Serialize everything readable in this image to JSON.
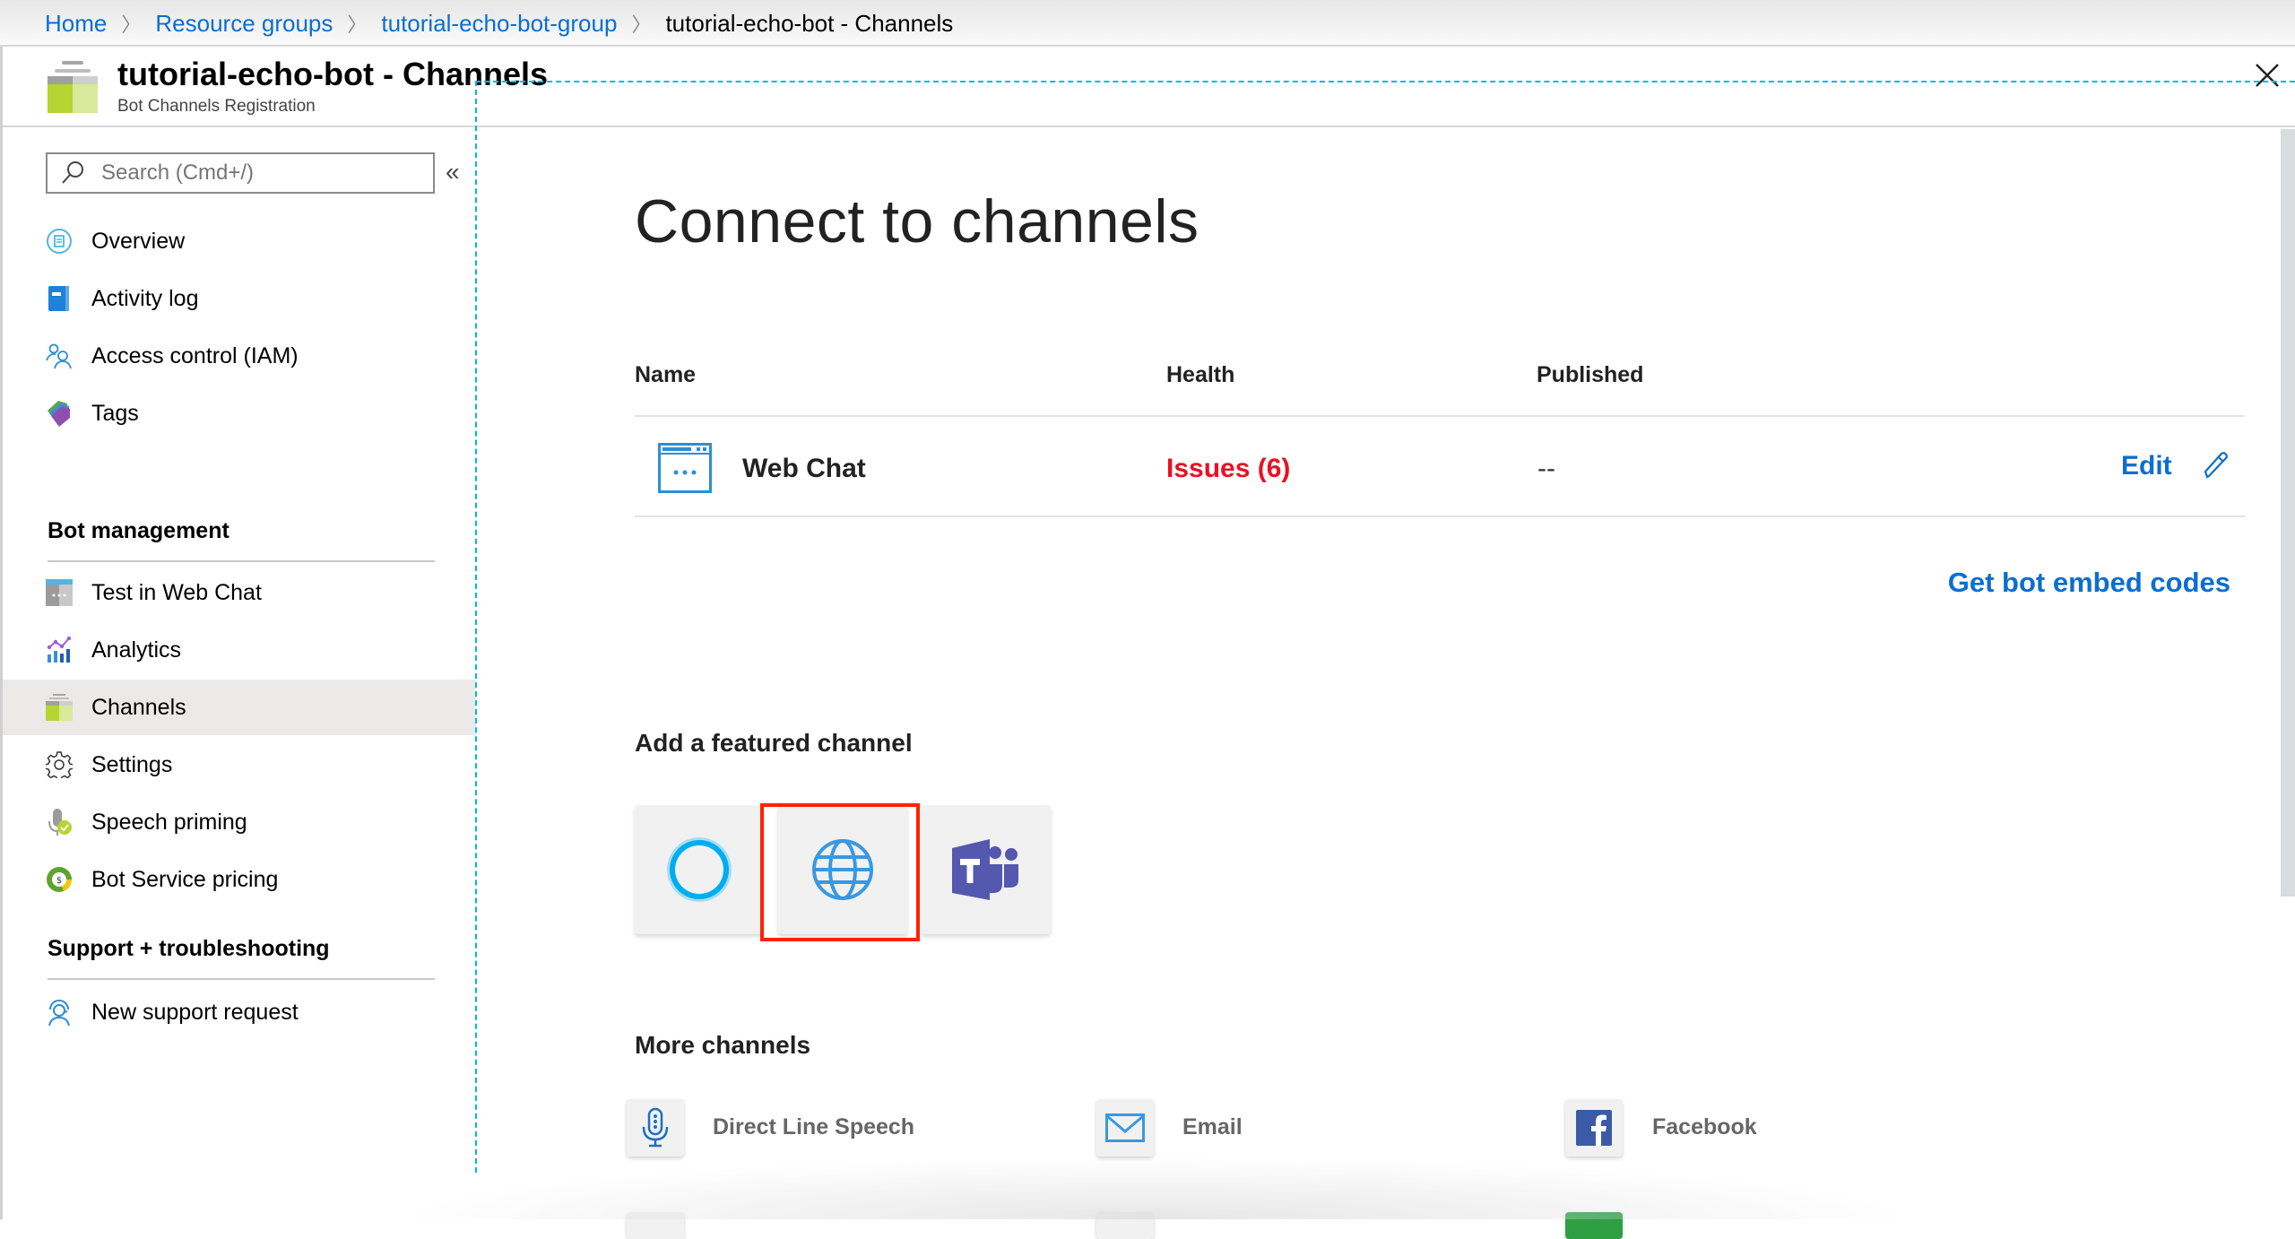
{
  "breadcrumb": {
    "items": [
      {
        "label": "Home"
      },
      {
        "label": "Resource groups"
      },
      {
        "label": "tutorial-echo-bot-group"
      }
    ],
    "current": "tutorial-echo-bot - Channels",
    "separator": ">"
  },
  "header": {
    "title": "tutorial-echo-bot - Channels",
    "subtitle": "Bot Channels Registration",
    "icon": "bot-channels-registration-icon",
    "close_icon": "close-icon"
  },
  "sidebar": {
    "search": {
      "placeholder": "Search (Cmd+/)",
      "value": ""
    },
    "collapse_label": "«",
    "items": [
      {
        "label": "Overview",
        "icon": "overview-icon"
      },
      {
        "label": "Activity log",
        "icon": "activity-log-icon"
      },
      {
        "label": "Access control (IAM)",
        "icon": "access-control-icon"
      },
      {
        "label": "Tags",
        "icon": "tags-icon"
      }
    ],
    "groups": [
      {
        "title": "Bot management",
        "items": [
          {
            "label": "Test in Web Chat",
            "icon": "web-chat-icon"
          },
          {
            "label": "Analytics",
            "icon": "analytics-icon"
          },
          {
            "label": "Channels",
            "icon": "channels-icon",
            "selected": true
          },
          {
            "label": "Settings",
            "icon": "gear-icon"
          },
          {
            "label": "Speech priming",
            "icon": "speech-priming-icon"
          },
          {
            "label": "Bot Service pricing",
            "icon": "pricing-icon"
          }
        ]
      },
      {
        "title": "Support + troubleshooting",
        "items": [
          {
            "label": "New support request",
            "icon": "support-icon"
          }
        ]
      }
    ]
  },
  "main": {
    "heading": "Connect to channels",
    "table": {
      "columns": [
        "Name",
        "Health",
        "Published"
      ],
      "rows": [
        {
          "name": "Web Chat",
          "icon": "web-chat-icon",
          "health": "Issues (6)",
          "published": "--",
          "action": "Edit"
        }
      ]
    },
    "embed_link": "Get bot embed codes",
    "featured": {
      "title": "Add a featured channel",
      "channels": [
        {
          "name": "Cortana",
          "icon": "cortana-icon"
        },
        {
          "name": "Web",
          "icon": "globe-icon",
          "highlighted": true
        },
        {
          "name": "Microsoft Teams",
          "icon": "teams-icon"
        }
      ]
    },
    "more": {
      "title": "More channels",
      "channels": [
        {
          "label": "Direct Line Speech",
          "icon": "microphone-icon"
        },
        {
          "label": "Email",
          "icon": "email-icon"
        },
        {
          "label": "Facebook",
          "icon": "facebook-icon"
        }
      ]
    }
  },
  "colors": {
    "link": "#0a6ed1",
    "error": "#e81123",
    "highlight_box": "#ff2200",
    "focus_dash": "#00b4f0",
    "selected_bg": "#ebeae8"
  }
}
